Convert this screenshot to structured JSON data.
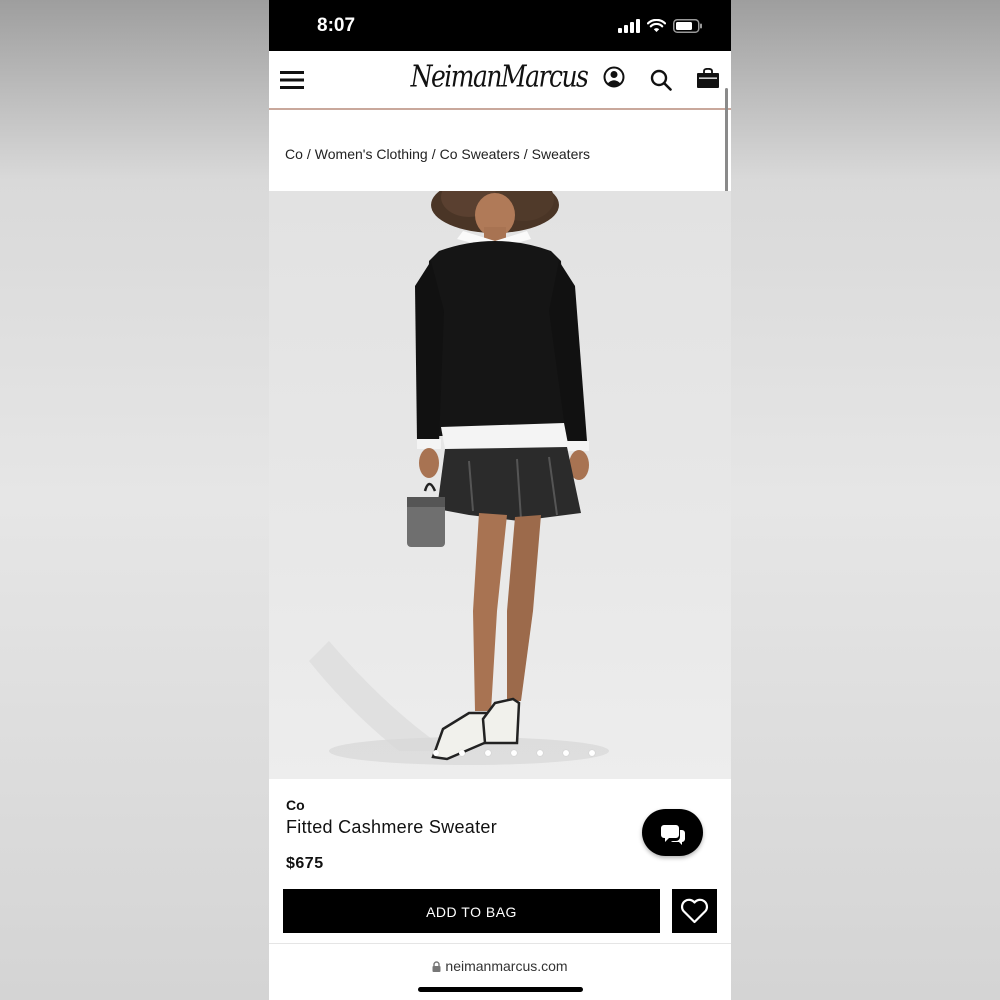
{
  "status_bar": {
    "time": "8:07"
  },
  "header": {
    "logo_text": "NeimanMarcus"
  },
  "breadcrumb": [
    "Co",
    "Women's Clothing",
    "Co Sweaters",
    "Sweaters"
  ],
  "breadcrumb_separator": "/",
  "product": {
    "brand": "Co",
    "name": "Fitted Cashmere Sweater",
    "price": "$675",
    "image_count": 7,
    "image_active_index": 0
  },
  "actions": {
    "add_to_bag_label": "ADD TO BAG"
  },
  "browser": {
    "url": "neimanmarcus.com"
  },
  "colors": {
    "accent_line": "#c9a89c",
    "button_bg": "#000000",
    "button_text": "#ffffff"
  }
}
